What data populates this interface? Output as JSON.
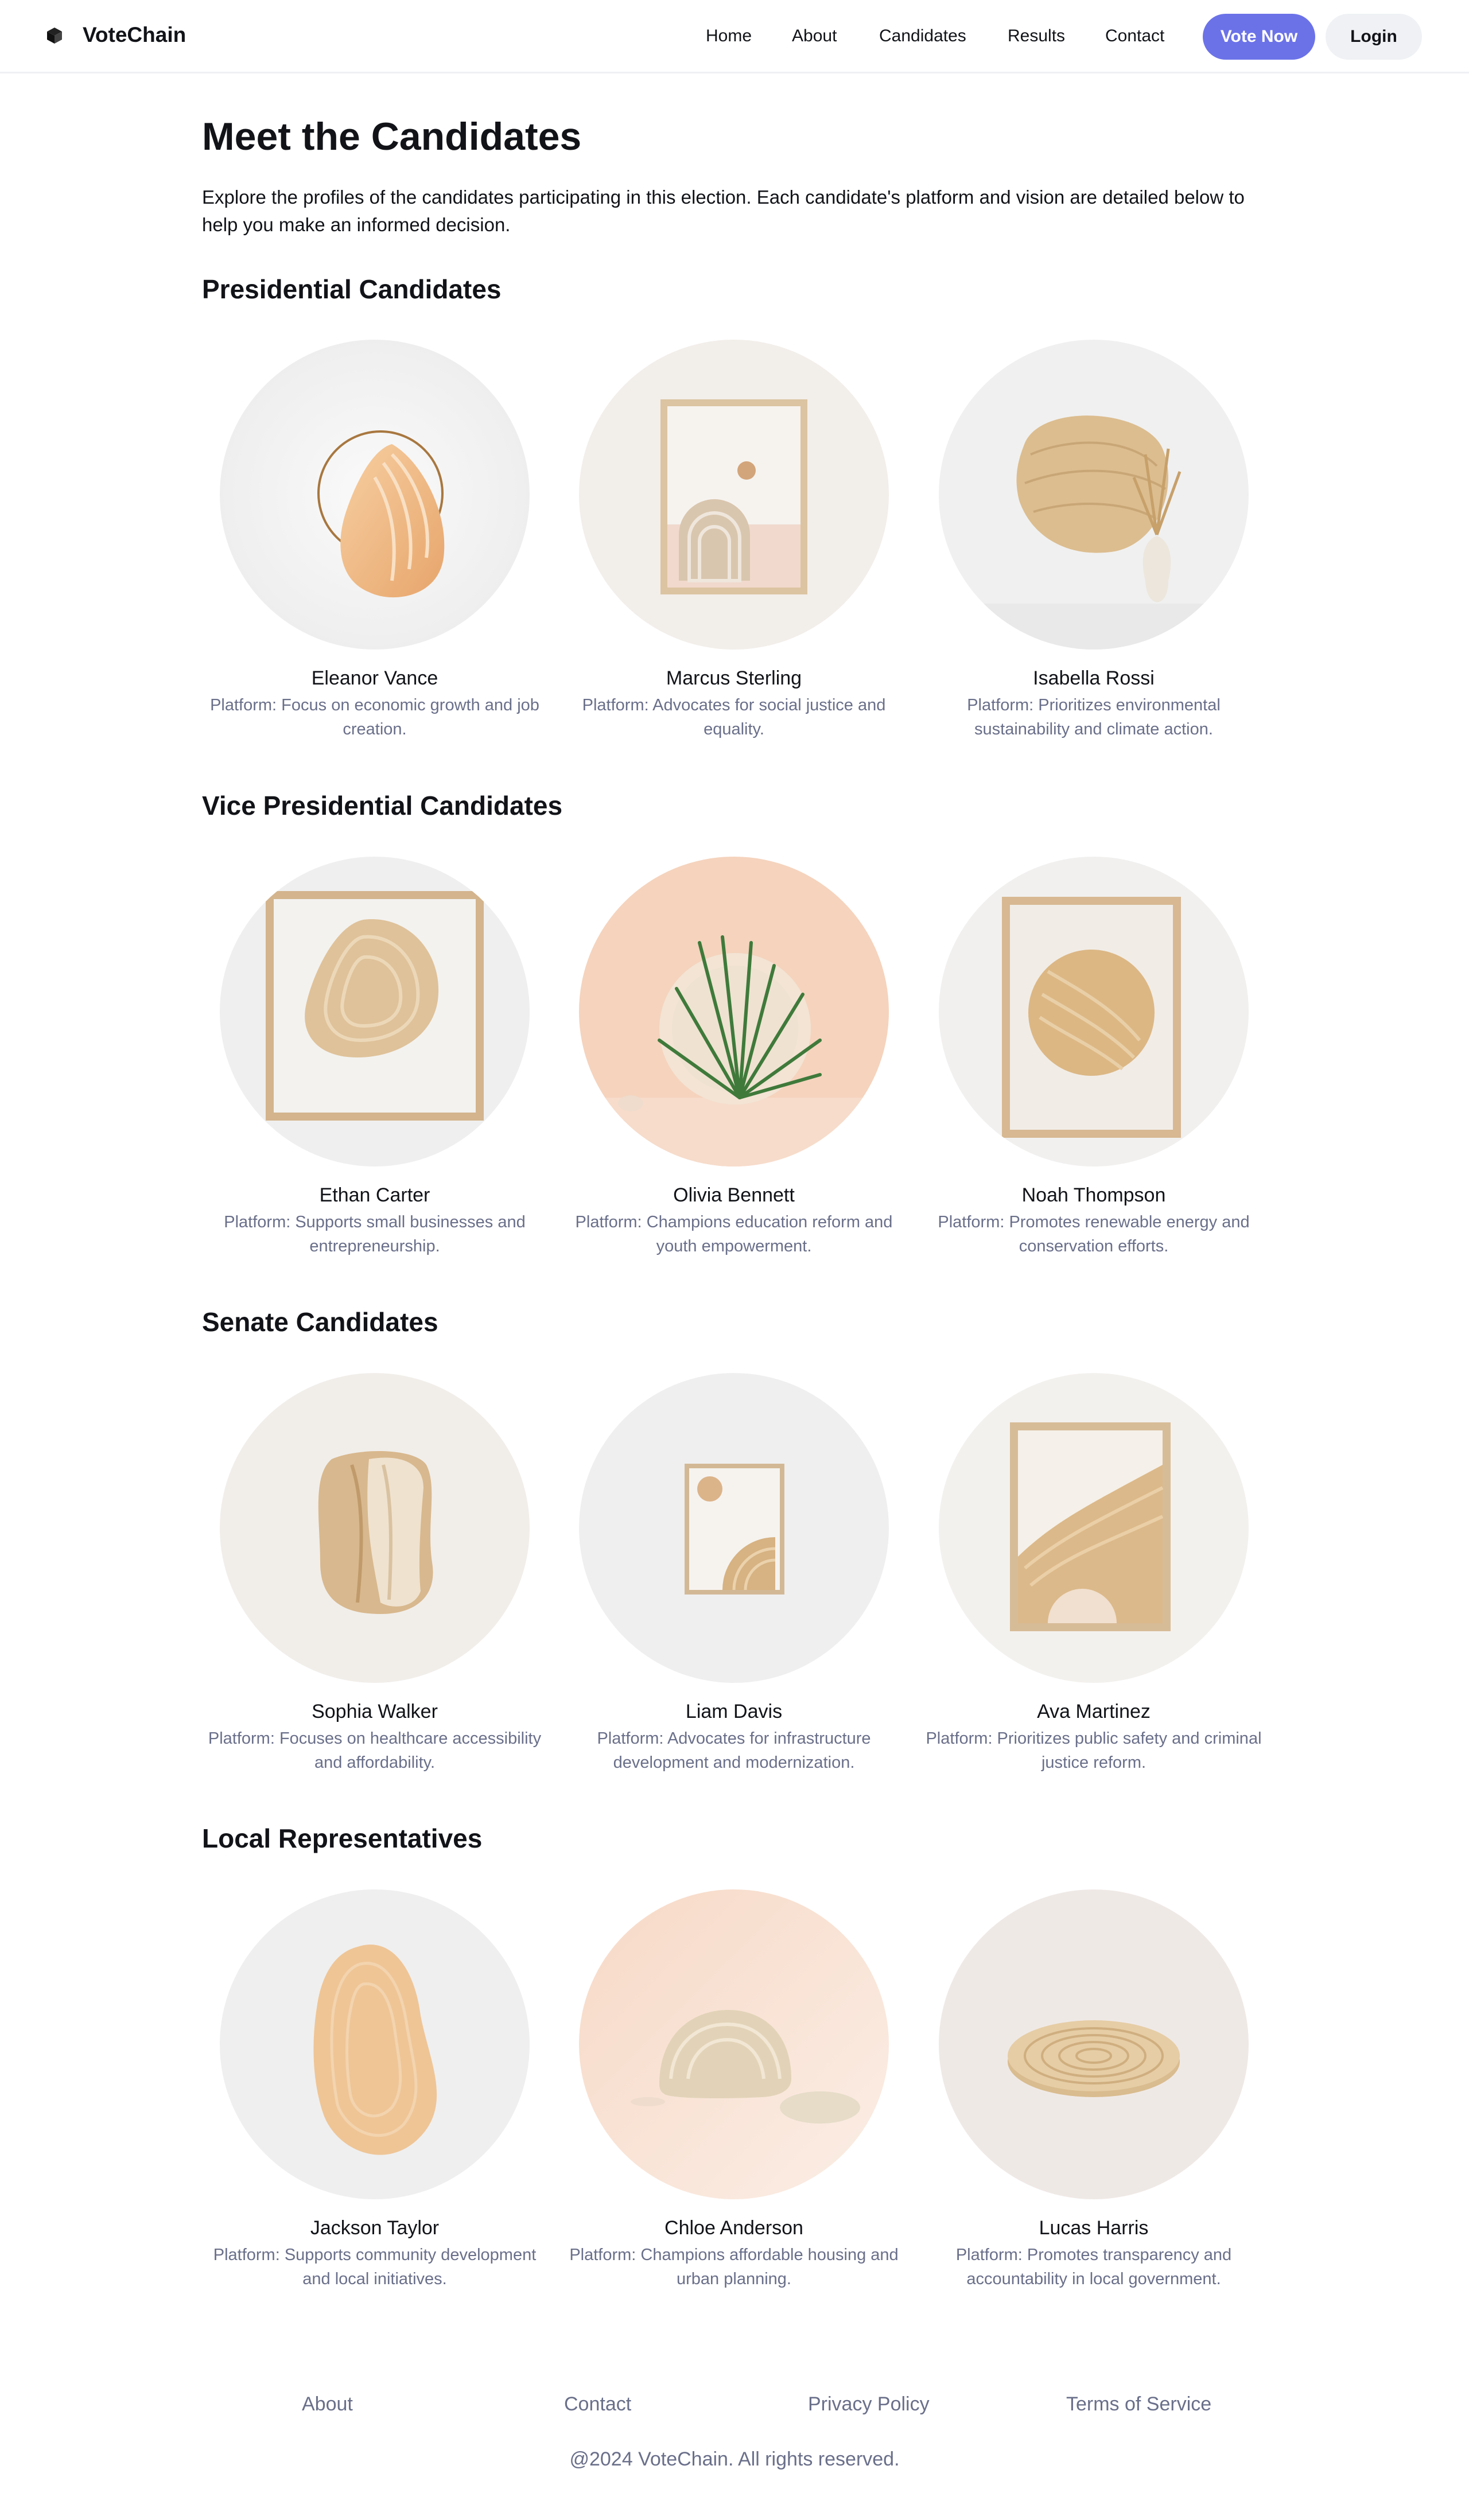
{
  "app": {
    "name": "VoteChain",
    "logo_icon": "cube-icon"
  },
  "nav": {
    "links": [
      "Home",
      "About",
      "Candidates",
      "Results",
      "Contact"
    ],
    "vote_button": "Vote Now",
    "login_button": "Login",
    "accent_color": "#6b72e8"
  },
  "page": {
    "title": "Meet the Candidates",
    "intro": "Explore the profiles of the candidates participating in this election. Each candidate's platform and vision are detailed below to help you make an informed decision."
  },
  "sections": [
    {
      "title": "Presidential Candidates",
      "candidates": [
        {
          "name": "Eleanor Vance",
          "platform": "Platform: Focus on economic growth and job creation.",
          "image": "shell-sculpture-art"
        },
        {
          "name": "Marcus Sterling",
          "platform": "Platform: Advocates for social justice and equality.",
          "image": "framed-arch-print-art"
        },
        {
          "name": "Isabella Rossi",
          "platform": "Platform: Prioritizes environmental sustainability and climate action.",
          "image": "wood-panel-vase-art"
        }
      ]
    },
    {
      "title": "Vice Presidential Candidates",
      "candidates": [
        {
          "name": "Ethan Carter",
          "platform": "Platform: Supports small businesses and entrepreneurship.",
          "image": "framed-wood-blob-art"
        },
        {
          "name": "Olivia Bennett",
          "platform": "Platform: Champions education reform and youth empowerment.",
          "image": "palm-leaf-disc-art"
        },
        {
          "name": "Noah Thompson",
          "platform": "Platform: Promotes renewable energy and conservation efforts.",
          "image": "framed-circle-print-art"
        }
      ]
    },
    {
      "title": "Senate Candidates",
      "candidates": [
        {
          "name": "Sophia Walker",
          "platform": "Platform: Focuses on healthcare accessibility and affordability.",
          "image": "layered-wood-slab-art"
        },
        {
          "name": "Liam Davis",
          "platform": "Platform: Advocates for infrastructure development and modernization.",
          "image": "small-framed-print-art"
        },
        {
          "name": "Ava Martinez",
          "platform": "Platform: Prioritizes public safety and criminal justice reform.",
          "image": "framed-wave-print-art"
        }
      ]
    },
    {
      "title": "Local Representatives",
      "candidates": [
        {
          "name": "Jackson Taylor",
          "platform": "Platform: Supports community development and local initiatives.",
          "image": "wood-blob-art"
        },
        {
          "name": "Chloe Anderson",
          "platform": "Platform: Champions affordable housing and urban planning.",
          "image": "shell-stones-art"
        },
        {
          "name": "Lucas Harris",
          "platform": "Platform: Promotes transparency and accountability in local government.",
          "image": "coiled-disc-art"
        }
      ]
    }
  ],
  "footer": {
    "links": [
      "About",
      "Contact",
      "Privacy Policy",
      "Terms of Service"
    ],
    "copyright": "@2024 VoteChain. All rights reserved."
  }
}
